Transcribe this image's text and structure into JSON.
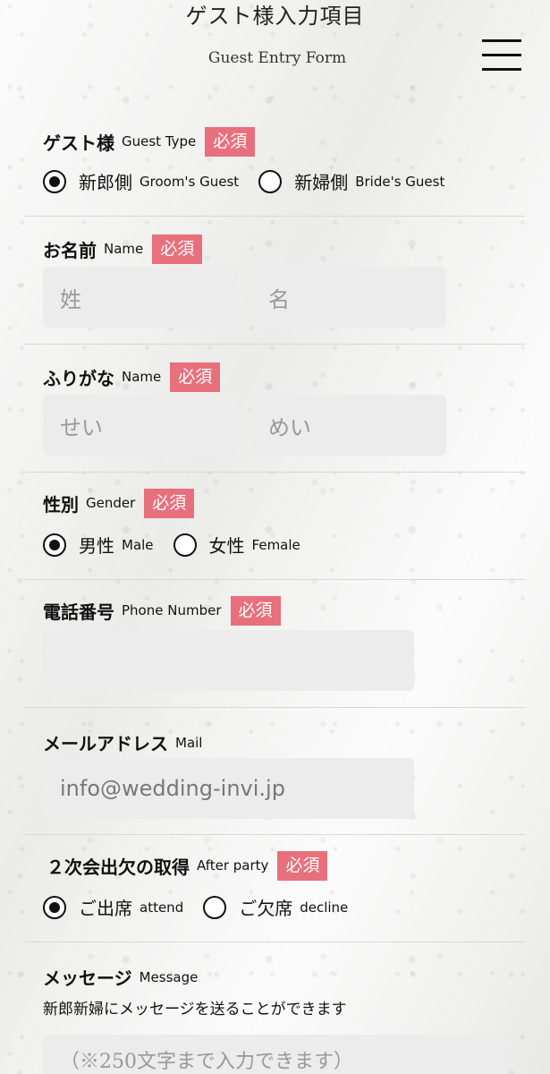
{
  "header": {
    "title": "ゲスト様入力項目",
    "subtitle": "Guest Entry Form",
    "menu_icon": "hamburger-menu-icon"
  },
  "required_label": "必須",
  "guest_type": {
    "label_ja": "ゲスト様",
    "label_en": "Guest Type",
    "options": [
      {
        "ja": "新郎側",
        "en": "Groom's Guest",
        "checked": true
      },
      {
        "ja": "新婦側",
        "en": "Bride's Guest",
        "checked": false
      }
    ]
  },
  "name": {
    "label_ja": "お名前",
    "label_en": "Name",
    "last_placeholder": "姓",
    "first_placeholder": "名"
  },
  "furigana": {
    "label_ja": "ふりがな",
    "label_en": "Name",
    "last_placeholder": "せい",
    "first_placeholder": "めい"
  },
  "gender": {
    "label_ja": "性別",
    "label_en": "Gender",
    "options": [
      {
        "ja": "男性",
        "en": "Male",
        "checked": true
      },
      {
        "ja": "女性",
        "en": "Female",
        "checked": false
      }
    ]
  },
  "phone": {
    "label_ja": "電話番号",
    "label_en": "Phone Number",
    "value": ""
  },
  "mail": {
    "label_ja": "メールアドレス",
    "label_en": "Mail",
    "placeholder": "info@wedding-invi.jp"
  },
  "after_party": {
    "label_ja": "２次会出欠の取得",
    "label_en": "After party",
    "options": [
      {
        "ja": "ご出席",
        "en": "attend",
        "checked": true
      },
      {
        "ja": "ご欠席",
        "en": "decline",
        "checked": false
      }
    ]
  },
  "message": {
    "label_ja": "メッセージ",
    "label_en": "Message",
    "description": "新郎新婦にメッセージを送ることができます",
    "placeholder": "（※250文字まで入力できます）"
  },
  "colors": {
    "required_badge": "#e8707c",
    "input_bg": "#ececec",
    "text": "#111111"
  }
}
